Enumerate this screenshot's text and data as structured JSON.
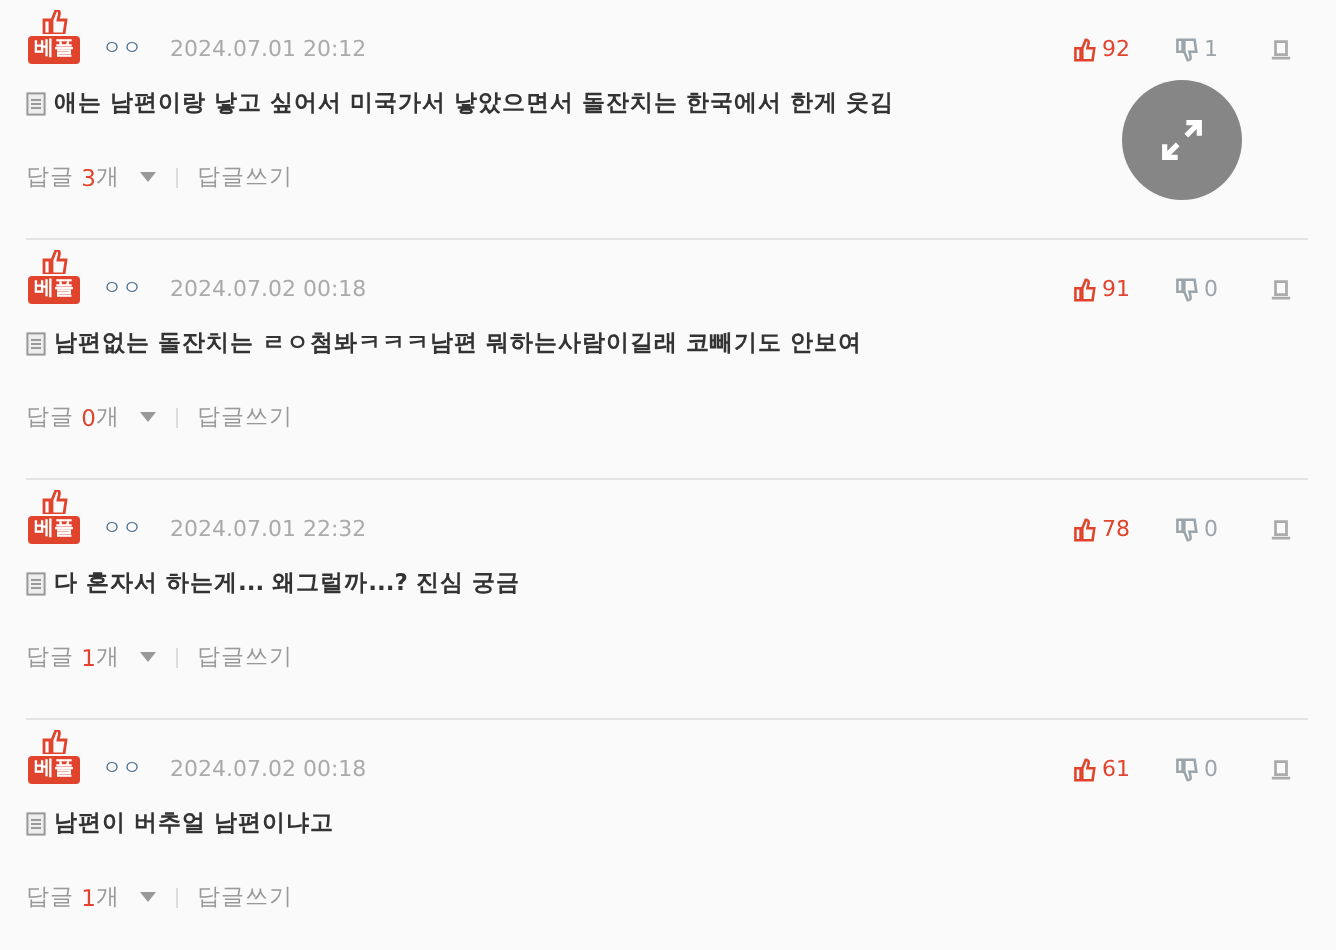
{
  "comments": [
    {
      "badge": "베플",
      "author": "ㅇㅇ",
      "date": "2024.07.01 20:12",
      "text": "애는 남편이랑 낳고 싶어서 미국가서 낳았으면서 돌잔치는 한국에서 한게 웃김",
      "likes": "92",
      "dislikes": "1",
      "reply_label": "답글",
      "reply_count": "3",
      "reply_unit": "개",
      "write_reply": "답글쓰기"
    },
    {
      "badge": "베플",
      "author": "ㅇㅇ",
      "date": "2024.07.02 00:18",
      "text": "남편없는 돌잔치는 ㄹㅇ첨봐ㅋㅋㅋ남편 뭐하는사람이길래 코빼기도 안보여",
      "likes": "91",
      "dislikes": "0",
      "reply_label": "답글",
      "reply_count": "0",
      "reply_unit": "개",
      "write_reply": "답글쓰기"
    },
    {
      "badge": "베플",
      "author": "ㅇㅇ",
      "date": "2024.07.01 22:32",
      "text": "다 혼자서 하는게... 왜그럴까...? 진심 궁금",
      "likes": "78",
      "dislikes": "0",
      "reply_label": "답글",
      "reply_count": "1",
      "reply_unit": "개",
      "write_reply": "답글쓰기"
    },
    {
      "badge": "베플",
      "author": "ㅇㅇ",
      "date": "2024.07.02 00:18",
      "text": "남편이 버추얼 남편이냐고",
      "likes": "61",
      "dislikes": "0",
      "reply_label": "답글",
      "reply_count": "1",
      "reply_unit": "개",
      "write_reply": "답글쓰기"
    }
  ]
}
